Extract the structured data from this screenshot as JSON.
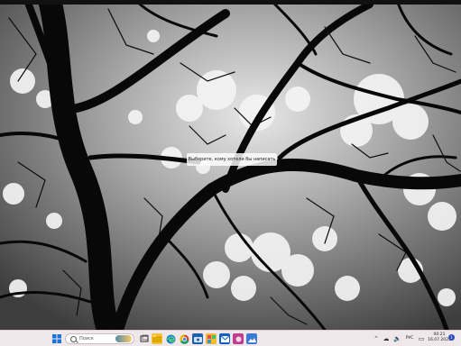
{
  "desktop": {
    "prompt_text": "Выберите, кому хотели бы написать",
    "wallpaper_icon": "tree-branches-wallpaper"
  },
  "taskbar": {
    "search_label": "Поиск",
    "language": "РУС",
    "time": "00:21",
    "date": "16.07.2023",
    "notification_count": "1",
    "icons": [
      "windows-start-icon",
      "search-icon",
      "task-view-icon",
      "file-explorer-icon",
      "edge-icon",
      "chrome-icon",
      "camera-icon",
      "store-icon",
      "mail-icon",
      "folder-icon",
      "app-icon",
      "photos-icon",
      "media-icon"
    ],
    "colors": {
      "taskbar": "#efe7ea",
      "accent": "#2b4bb5"
    }
  }
}
